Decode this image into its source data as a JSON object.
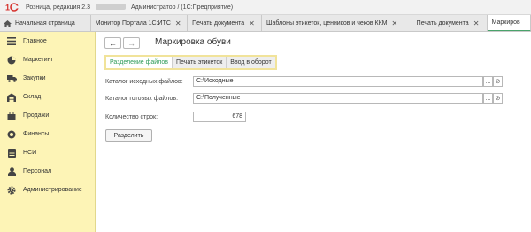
{
  "window": {
    "title_left": "Розница, редакция 2.3",
    "title_right": "Администратор / (1С:Предприятие)"
  },
  "tabs": [
    {
      "label": "Начальная страница"
    },
    {
      "label": "Монитор Портала 1С:ИТС"
    },
    {
      "label": "Печать документа"
    },
    {
      "label": "Шаблоны этикеток, ценников и чеков ККМ"
    },
    {
      "label": "Печать документа"
    },
    {
      "label": "Маркиров"
    }
  ],
  "sidebar": {
    "items": [
      {
        "label": "Главное",
        "icon": "menu-lines-icon"
      },
      {
        "label": "Маркетинг",
        "icon": "pie-chart-icon"
      },
      {
        "label": "Закупки",
        "icon": "truck-icon"
      },
      {
        "label": "Склад",
        "icon": "warehouse-icon"
      },
      {
        "label": "Продажи",
        "icon": "cart-icon"
      },
      {
        "label": "Финансы",
        "icon": "coin-icon"
      },
      {
        "label": "НСИ",
        "icon": "database-icon"
      },
      {
        "label": "Персонал",
        "icon": "person-icon"
      },
      {
        "label": "Администрирование",
        "icon": "gear-icon"
      }
    ]
  },
  "main": {
    "back_glyph": "←",
    "forward_glyph": "→",
    "title": "Маркировка обуви",
    "subtabs": [
      {
        "label": "Разделение файлов"
      },
      {
        "label": "Печать этикеток"
      },
      {
        "label": "Ввод в оборот"
      }
    ],
    "source_dir": {
      "label": "Каталог исходных файлов:",
      "value": "C:\\Исходные"
    },
    "ready_dir": {
      "label": "Каталог готовых файлов:",
      "value": "C:\\Полученные"
    },
    "row_count": {
      "label": "Количество строк:",
      "value": "678"
    },
    "split_button": "Разделить",
    "select_glyph": "...",
    "open_glyph": "⊘"
  },
  "colors": {
    "sidebar_bg": "#fdf4b6",
    "accent_green": "#2e9b58",
    "logo_red": "#d6322d"
  }
}
